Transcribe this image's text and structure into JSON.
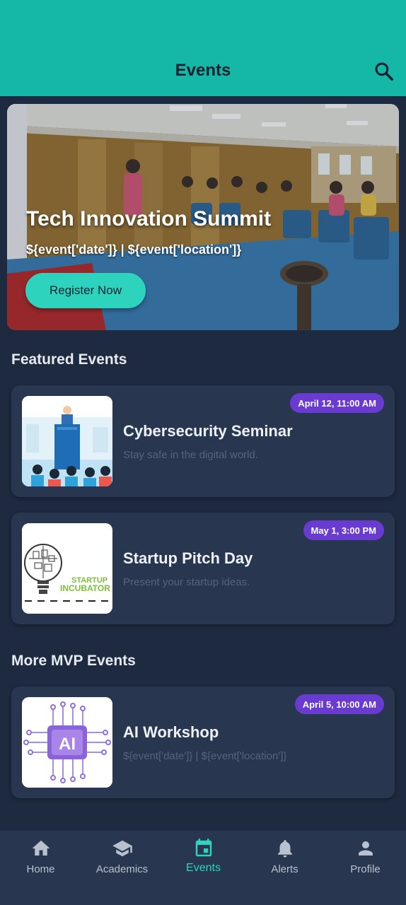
{
  "header": {
    "title": "Events",
    "search_icon": "search-icon"
  },
  "hero": {
    "title": "Tech Innovation Summit",
    "subtitle": "${event['date']} | ${event['location']}",
    "button_label": "Register Now"
  },
  "featured": {
    "heading": "Featured Events",
    "items": [
      {
        "title": "Cybersecurity Seminar",
        "description": "Stay safe in the digital world.",
        "badge": "April 12, 11:00 AM"
      },
      {
        "title": "Startup Pitch Day",
        "description": "Present your startup ideas.",
        "badge": "May 1, 3:00 PM",
        "thumb_text_1": "STARTUP",
        "thumb_text_2": "INCUBATOR"
      }
    ]
  },
  "more": {
    "heading": "More MVP Events",
    "items": [
      {
        "title": "AI Workshop",
        "description": "${event['date']} | ${event['location']}",
        "badge": "April 5, 10:00 AM",
        "thumb_text": "AI"
      }
    ]
  },
  "nav": {
    "items": [
      {
        "label": "Home",
        "icon": "home-icon"
      },
      {
        "label": "Academics",
        "icon": "graduation-cap-icon"
      },
      {
        "label": "Events",
        "icon": "calendar-icon",
        "active": true
      },
      {
        "label": "Alerts",
        "icon": "bell-icon"
      },
      {
        "label": "Profile",
        "icon": "person-icon"
      }
    ]
  },
  "colors": {
    "header_bg": "#15b8a6",
    "accent": "#2ed3be",
    "badge_bg": "#6a3bd0",
    "page_bg": "#1e2a3f",
    "card_bg": "#283650"
  }
}
